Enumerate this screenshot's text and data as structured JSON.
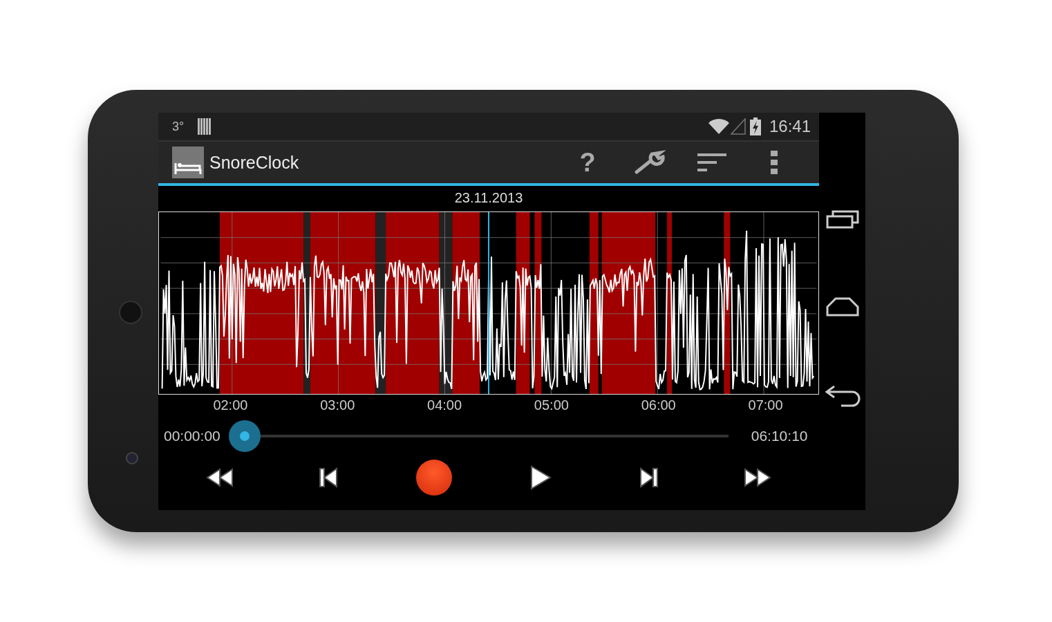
{
  "status_bar": {
    "temperature": "3°",
    "time": "16:41"
  },
  "action_bar": {
    "title": "SnoreClock",
    "help": "?",
    "actions": [
      {
        "kind": "settings"
      },
      {
        "kind": "sort"
      },
      {
        "kind": "overflow"
      }
    ]
  },
  "date": "23.11.2013",
  "time_axis": [
    "02:00",
    "03:00",
    "04:00",
    "05:00",
    "06:00",
    "07:00"
  ],
  "playback": {
    "elapsed": "00:00:00",
    "total": "06:10:10",
    "level": 0
  },
  "transport": [
    {
      "kind": "rewind"
    },
    {
      "kind": "previous"
    },
    {
      "kind": "record"
    },
    {
      "kind": "play"
    },
    {
      "kind": "next"
    },
    {
      "kind": "fast_forward"
    }
  ]
}
